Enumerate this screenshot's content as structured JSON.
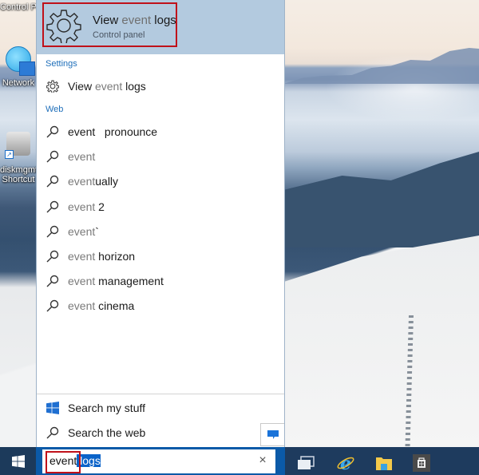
{
  "desktop": {
    "top_label": "Control Panel",
    "icons": [
      {
        "label": "Network",
        "icon": "network-globe-icon"
      },
      {
        "label": "diskmgmt - Shortcut",
        "line1": "diskmgmt",
        "line2": "Shortcut",
        "icon": "disk-management-icon"
      }
    ]
  },
  "search_panel": {
    "best_match": {
      "title_prefix": "View ",
      "title_match": "event",
      "title_suffix": " logs",
      "subtitle": "Control panel",
      "icon": "gear-icon"
    },
    "settings": {
      "heading": "Settings",
      "items": [
        {
          "prefix": "View ",
          "match": "event",
          "suffix": " logs",
          "icon": "gear-icon"
        }
      ]
    },
    "web": {
      "heading": "Web",
      "items": [
        {
          "match": "event",
          "suffix": "   pronounce",
          "match_dark": true,
          "icon": "search-icon"
        },
        {
          "match": "event",
          "suffix": "",
          "icon": "search-icon"
        },
        {
          "match": "event",
          "suffix": "ually",
          "icon": "search-icon"
        },
        {
          "match": "event",
          "suffix": " 2",
          "icon": "search-icon"
        },
        {
          "match": "event",
          "suffix": "`",
          "icon": "search-icon"
        },
        {
          "match": "event",
          "suffix": " horizon",
          "icon": "search-icon"
        },
        {
          "match": "event",
          "suffix": " management",
          "icon": "search-icon"
        },
        {
          "match": "event",
          "suffix": " cinema",
          "icon": "search-icon"
        }
      ]
    },
    "footer": {
      "search_my_stuff": "Search my stuff",
      "search_the_web": "Search the web"
    }
  },
  "taskbar": {
    "search_input": {
      "typed": "event",
      "autocomplete_selected": " logs",
      "clear_glyph": "×"
    },
    "pinned": [
      "task-view",
      "internet-explorer",
      "file-explorer",
      "store"
    ]
  },
  "colors": {
    "accent": "#0b5aa8",
    "highlight_red": "#c0111a",
    "best_match_bg": "#b3cadf",
    "section_heading": "#1f6fba",
    "taskbar": "#1e3b5e"
  }
}
